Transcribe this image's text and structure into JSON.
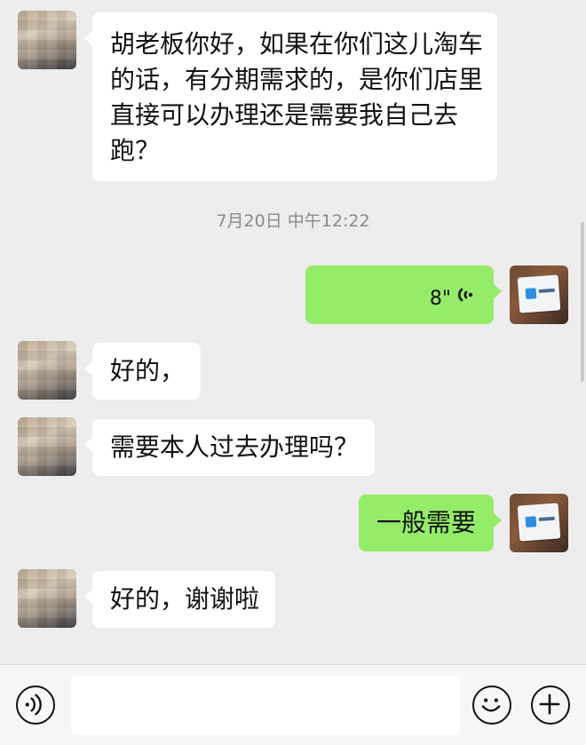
{
  "messages": [
    {
      "side": "in",
      "type": "text",
      "text": "胡老板你好，如果在你们这儿淘车的话，有分期需求的，是你们店里直接可以办理还是需要我自己去跑？"
    },
    {
      "type": "timestamp",
      "text": "7月20日 中午12:22"
    },
    {
      "side": "out",
      "type": "voice",
      "duration": "8\""
    },
    {
      "side": "in",
      "type": "text",
      "text": "好的，"
    },
    {
      "side": "in",
      "type": "text",
      "text": "需要本人过去办理吗？"
    },
    {
      "side": "out",
      "type": "text",
      "text": "一般需要"
    },
    {
      "side": "in",
      "type": "text",
      "text": "好的，谢谢啦"
    }
  ],
  "input_bar": {
    "voice_toggle_icon": "voice-mode-icon",
    "emoji_icon": "emoji-icon",
    "plus_icon": "plus-icon",
    "input_value": ""
  },
  "colors": {
    "background": "#ededed",
    "incoming_bubble": "#ffffff",
    "outgoing_bubble": "#95ec69",
    "timestamp_text": "#8a8a8a"
  }
}
